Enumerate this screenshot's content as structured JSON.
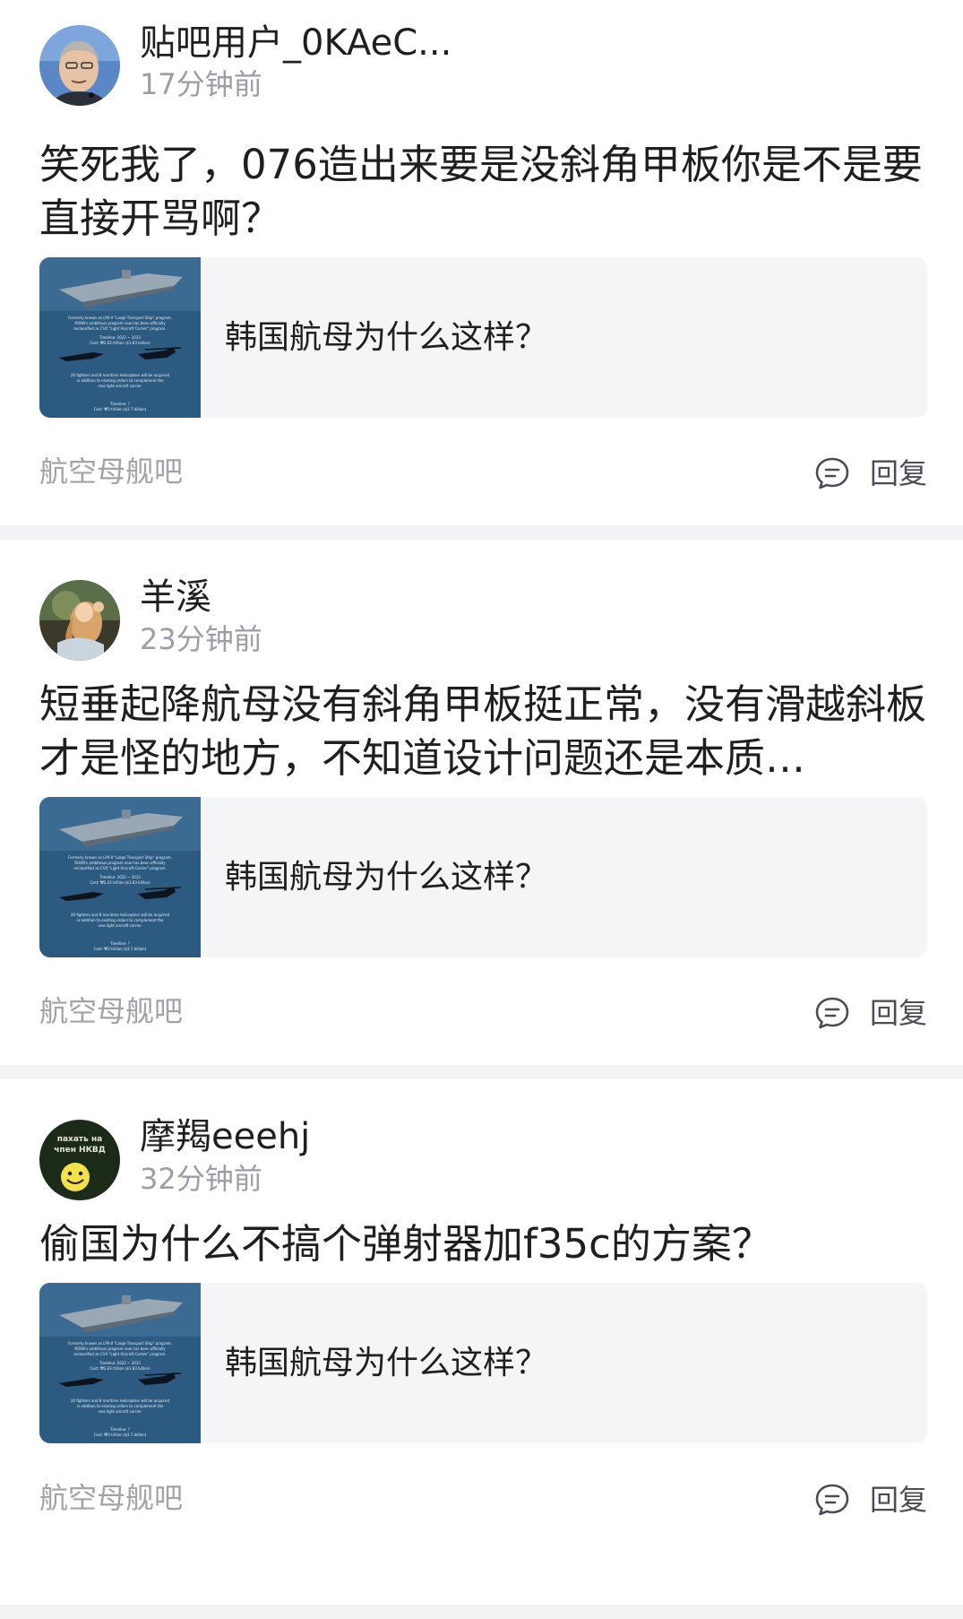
{
  "posts": [
    {
      "username": "贴吧用户_0KAeC...",
      "time": "17分钟前",
      "content": "笑死我了，076造出来要是没斜角甲板你是不是要直接开骂啊？",
      "link_title": "韩国航母为什么这样？",
      "forum": "航空母舰吧",
      "reply_label": "回复",
      "avatar_icon": "person-photo-avatar"
    },
    {
      "username": "羊溪",
      "time": "23分钟前",
      "content": "短垂起降航母没有斜角甲板挺正常，没有滑越斜板才是怪的地方，不知道设计问题还是本质…",
      "link_title": "韩国航母为什么这样？",
      "forum": "航空母舰吧",
      "reply_label": "回复",
      "avatar_icon": "painting-avatar"
    },
    {
      "username": "摩羯eeehj",
      "time": "32分钟前",
      "content": "偷国为什么不搞个弹射器加f35c的方案？",
      "link_title": "韩国航母为什么这样？",
      "forum": "航空母舰吧",
      "reply_label": "回复",
      "avatar_icon": "smiley-avatar"
    }
  ],
  "thumbnail_text": {
    "line1": "Formerly known as LPX-II \"Large Transport Ship\" program,",
    "line2": "ROKN's ambitious program now has been officially",
    "line3": "reclassified as CVX \"Light Aircraft Carrier\" program.",
    "line4": "Timeline: 2022 ~ 2033",
    "line5": "Cost: ₩2.03 trillion ($1.83 billion)",
    "line6": "20 fighters and 8 maritime helicopters will be acquired",
    "line7": "in addition to existing orders to complement the",
    "line8": "new light aircraft carrier.",
    "line9": "Timeline: ?",
    "line10": "Cost: ₩3 trillion ($2.7 billion)"
  },
  "avatar3_text": {
    "line1": "пaxaть нa",
    "line2": "чпeн НКВД"
  },
  "colors": {
    "text": "#1f1f1f",
    "muted": "#9b9ea6",
    "link_bg": "#f4f5f7",
    "separator": "#f2f3f5",
    "thumb_bg": "#2d5a80"
  }
}
